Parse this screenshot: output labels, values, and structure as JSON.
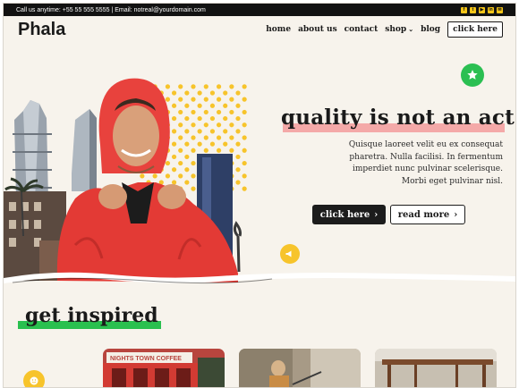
{
  "topbar": {
    "contact": "Call us anytime: +55 55 555 5555 |  Email: notreal@yourdomain.com",
    "socials": [
      {
        "icon": "facebook-icon",
        "glyph": "f"
      },
      {
        "icon": "twitter-icon",
        "glyph": "t"
      },
      {
        "icon": "youtube-icon",
        "glyph": "▶"
      },
      {
        "icon": "linkedin-icon",
        "glyph": "in"
      },
      {
        "icon": "email-icon",
        "glyph": "✉"
      }
    ],
    "social_color": "#f5c518"
  },
  "header": {
    "logo": "Phala",
    "nav": {
      "home": "home",
      "about": "about us",
      "contact": "contact",
      "shop": "shop",
      "blog": "blog",
      "cta": "click here"
    }
  },
  "hero": {
    "title": "quality is not an act",
    "text": "Quisque laoreet velit eu ex consequat pharetra. Nulla facilisi. In fermentum imperdiet nunc pulvinar scelerisque. Morbi eget pulvinar nisl.",
    "primary_button": "click here",
    "secondary_button": "read more",
    "accent_pink": "#f4a9a8",
    "accent_green": "#2bbf52",
    "accent_yellow": "#f7c42b"
  },
  "section": {
    "title": "get inspired",
    "accent": "#2ac04f"
  },
  "cards": [
    {
      "name": "storefront-photo",
      "sign": "NIGHTS TOWN COFFEE"
    },
    {
      "name": "street-photo"
    },
    {
      "name": "furniture-photo"
    }
  ]
}
